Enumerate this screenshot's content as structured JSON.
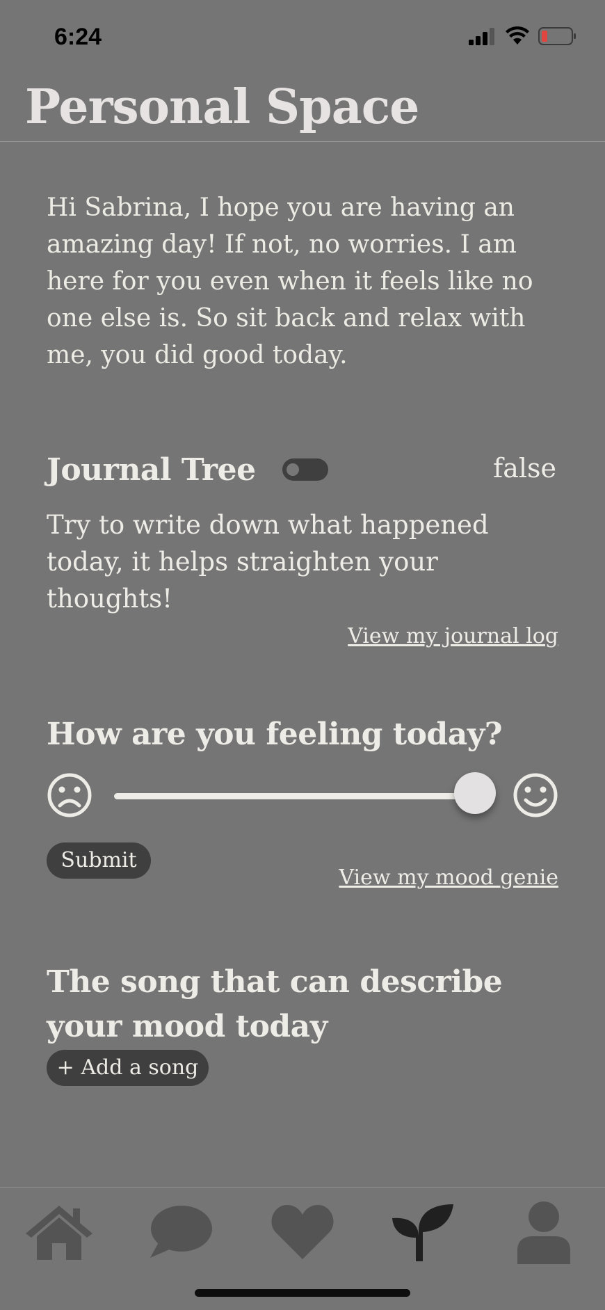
{
  "status_bar": {
    "time": "6:24",
    "icons": [
      "cellular-signal-icon",
      "wifi-icon",
      "battery-low-icon"
    ]
  },
  "header": {
    "title": "Personal Space"
  },
  "greeting": "Hi Sabrina, I hope you are having an amazing day! If not, no worries. I am here for you even when it feels like no one else is. So sit back and relax with me, you did good today.",
  "journal": {
    "title": "Journal Tree",
    "toggle_value": "false",
    "description": "Try to write down what happened today, it helps straighten your thoughts!",
    "log_link": "View my journal log"
  },
  "mood": {
    "title": "How are you feeling today?",
    "slider_value": 1.0,
    "left_icon": "sad-face-icon",
    "right_icon": "happy-face-icon",
    "submit_label": "Submit",
    "genie_link": "View my mood genie"
  },
  "song": {
    "title": "The song that can describe your mood today",
    "add_label": "+ Add a song"
  },
  "tab_bar": {
    "tabs": [
      {
        "icon": "home-icon",
        "active": false
      },
      {
        "icon": "chat-bubble-icon",
        "active": false
      },
      {
        "icon": "heart-icon",
        "active": false
      },
      {
        "icon": "sprout-icon",
        "active": true
      },
      {
        "icon": "profile-icon",
        "active": false
      }
    ]
  },
  "colors": {
    "background": "#757575",
    "text": "#eeece6",
    "dark_button": "#3f3f3f",
    "inactive_tab": "#545454",
    "active_tab": "#202020",
    "battery_low": "#e0463f"
  }
}
